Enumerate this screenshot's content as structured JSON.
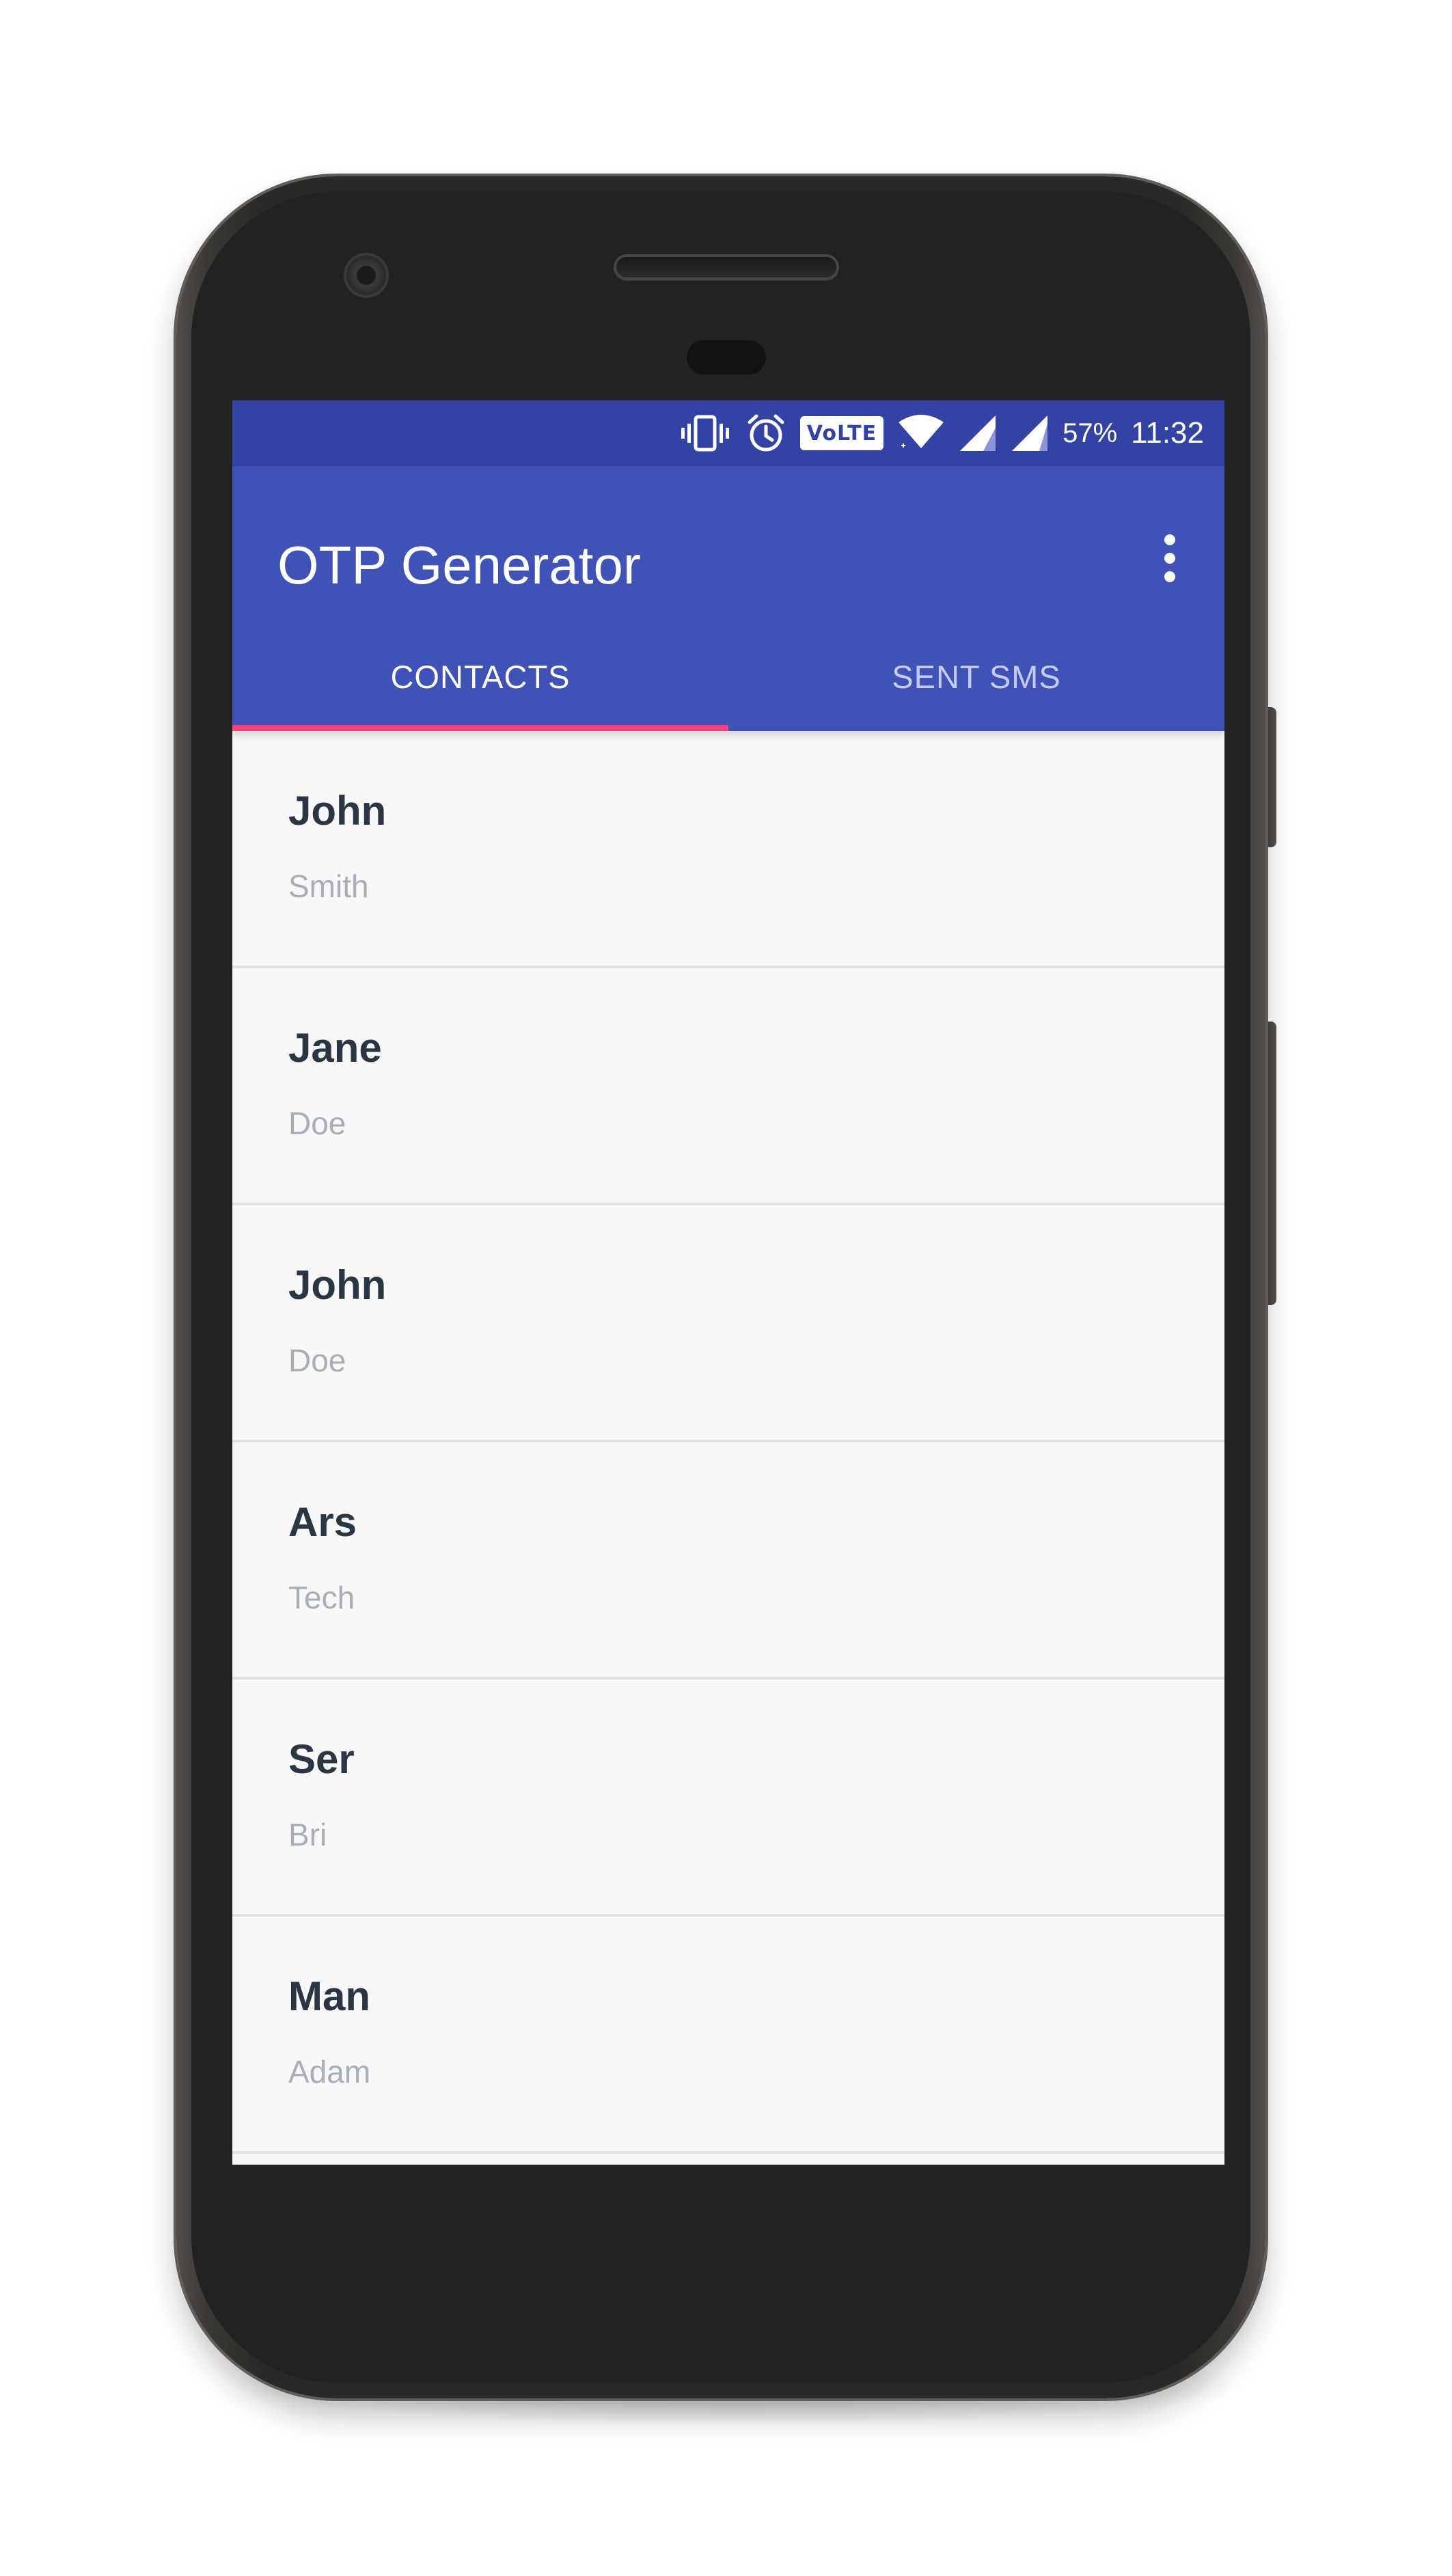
{
  "status_bar": {
    "battery": "57%",
    "time": "11:32",
    "volte_label": "VoLTE",
    "icons": [
      "vibrate-icon",
      "alarm-icon",
      "volte-icon",
      "wifi-icon",
      "signal-icon",
      "signal-icon"
    ]
  },
  "app_bar": {
    "title": "OTP Generator",
    "menu_icon": "more-vert-icon"
  },
  "tabs": [
    {
      "label": "CONTACTS",
      "active": true
    },
    {
      "label": "SENT SMS",
      "active": false
    }
  ],
  "contacts": [
    {
      "first_name": "John",
      "last_name": "Smith"
    },
    {
      "first_name": "Jane",
      "last_name": "Doe"
    },
    {
      "first_name": "John",
      "last_name": "Doe"
    },
    {
      "first_name": "Ars",
      "last_name": "Tech"
    },
    {
      "first_name": "Ser",
      "last_name": "Bri"
    },
    {
      "first_name": "Man",
      "last_name": "Adam"
    }
  ],
  "colors": {
    "status_bar": "#3342a3",
    "primary": "#4052b5",
    "accent": "#f0457e",
    "list_background": "#f8f8f8",
    "primary_text": "#2b3645",
    "secondary_text": "#a8aeb8"
  }
}
